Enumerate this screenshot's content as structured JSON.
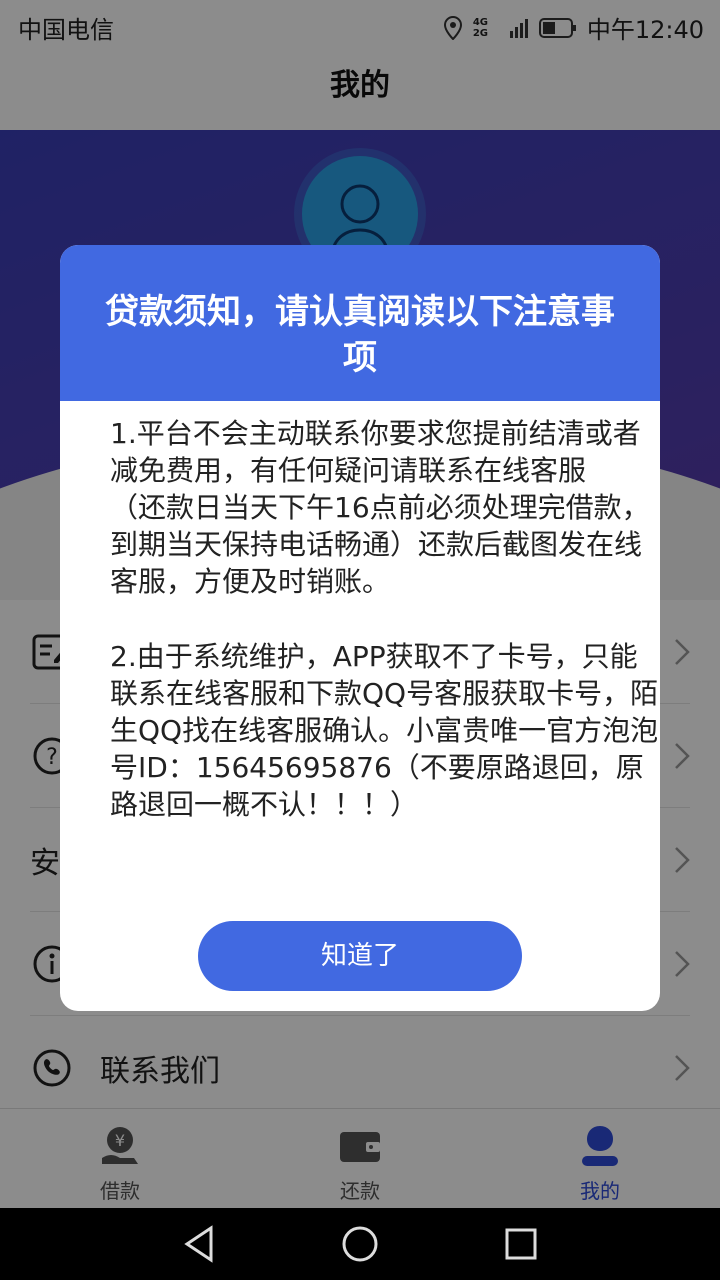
{
  "status_bar": {
    "carrier": "中国电信",
    "network": "4G 2G",
    "time": "中午12:40"
  },
  "header": {
    "title": "我的"
  },
  "menu": {
    "items": [
      {
        "label": "",
        "icon": "edit-note-icon"
      },
      {
        "label": "",
        "icon": "question-icon"
      },
      {
        "label": "安",
        "icon": ""
      },
      {
        "label": "",
        "icon": "info-icon"
      },
      {
        "label": "联系我们",
        "icon": "phone-icon"
      }
    ]
  },
  "tabbar": {
    "tabs": [
      {
        "label": "借款",
        "icon": "yen-hand-icon"
      },
      {
        "label": "还款",
        "icon": "wallet-icon"
      },
      {
        "label": "我的",
        "icon": "user-icon"
      }
    ]
  },
  "dialog": {
    "title": "贷款须知，请认真阅读以下注意事项",
    "paragraph_1": "1.平台不会主动联系你要求您提前结清或者减免费用，有任何疑问请联系在线客服\n（还款日当天下午16点前必须处理完借款，到期当天保持电话畅通）还款后截图发在线客服，方便及时销账。",
    "paragraph_2": "2.由于系统维护，APP获取不了卡号，只能联系在线客服和下款QQ号客服获取卡号，陌生QQ找在线客服确认。小富贵唯一官方泡泡号ID：15645695876（不要原路退回，原路退回一概不认！！！）",
    "confirm_label": "知道了"
  },
  "colors": {
    "accent": "#4169e1",
    "hero_gradient": "#3a3fb8",
    "avatar": "#2aa0e6"
  }
}
